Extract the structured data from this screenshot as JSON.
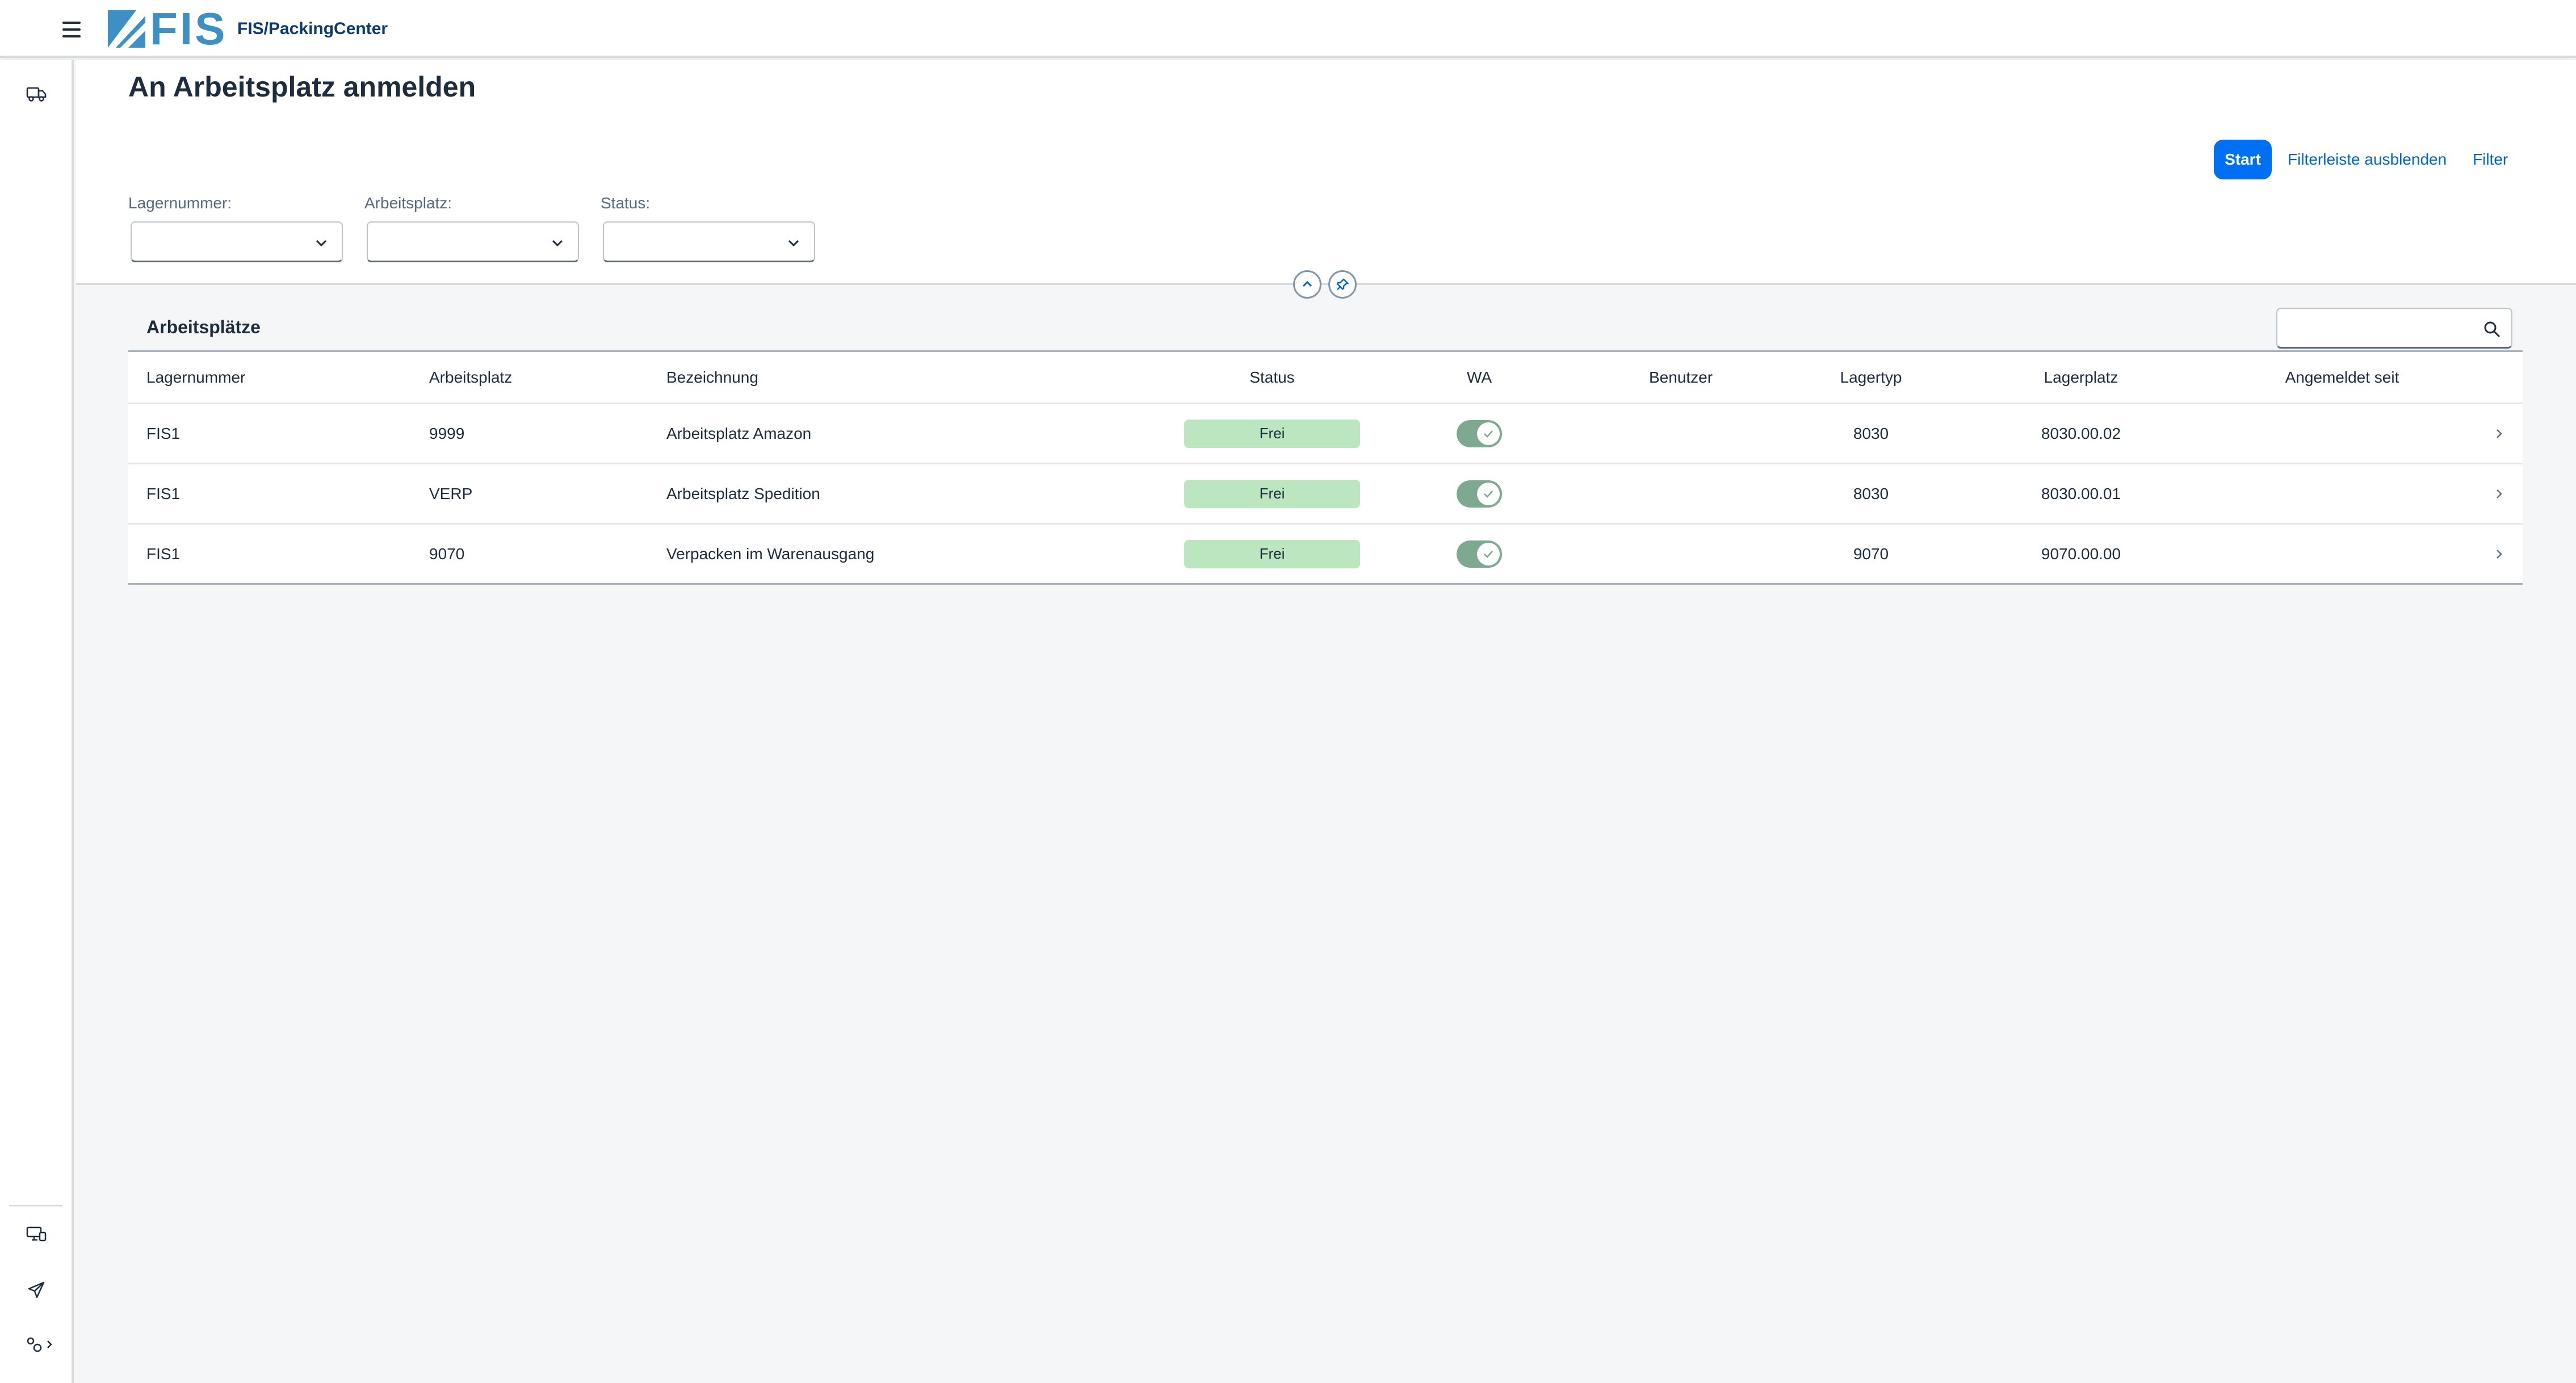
{
  "shell": {
    "logo_text": "FIS",
    "app_title": "FIS/PackingCenter"
  },
  "page": {
    "title": "An Arbeitsplatz anmelden"
  },
  "filterbar": {
    "start_label": "Start",
    "hide_label": "Filterleiste ausblenden",
    "filter_label": "Filter",
    "fields": [
      {
        "label": "Lagernummer:",
        "value": ""
      },
      {
        "label": "Arbeitsplatz:",
        "value": ""
      },
      {
        "label": "Status:",
        "value": ""
      }
    ]
  },
  "table": {
    "title": "Arbeitsplätze",
    "search_value": "",
    "columns": [
      "Lagernummer",
      "Arbeitsplatz",
      "Bezeichnung",
      "Status",
      "WA",
      "Benutzer",
      "Lagertyp",
      "Lagerplatz",
      "Angemeldet seit"
    ],
    "rows": [
      {
        "lagernummer": "FIS1",
        "arbeitsplatz": "9999",
        "bezeichnung": "Arbeitsplatz Amazon",
        "status": "Frei",
        "wa": true,
        "benutzer": "",
        "lagertyp": "8030",
        "lagerplatz": "8030.00.02",
        "angemeldet_seit": ""
      },
      {
        "lagernummer": "FIS1",
        "arbeitsplatz": "VERP",
        "bezeichnung": "Arbeitsplatz Spedition",
        "status": "Frei",
        "wa": true,
        "benutzer": "",
        "lagertyp": "8030",
        "lagerplatz": "8030.00.01",
        "angemeldet_seit": ""
      },
      {
        "lagernummer": "FIS1",
        "arbeitsplatz": "9070",
        "bezeichnung": "Verpacken im Warenausgang",
        "status": "Frei",
        "wa": true,
        "benutzer": "",
        "lagertyp": "9070",
        "lagerplatz": "9070.00.00",
        "angemeldet_seit": ""
      }
    ]
  },
  "icons": {
    "menu": "hamburger-icon",
    "nav_top": "truck-icon",
    "nav_bottom": [
      "monitor-icon",
      "paper-plane-icon",
      "settings-expand-icon"
    ],
    "search": "search-icon",
    "dropdown": "chevron-down-icon",
    "row_nav": "chevron-right-icon"
  },
  "colors": {
    "brand": "#3e8fc4",
    "accent": "#0070f2",
    "status_success_bg": "#bbe6bf",
    "switch_on": "#7fa890"
  }
}
